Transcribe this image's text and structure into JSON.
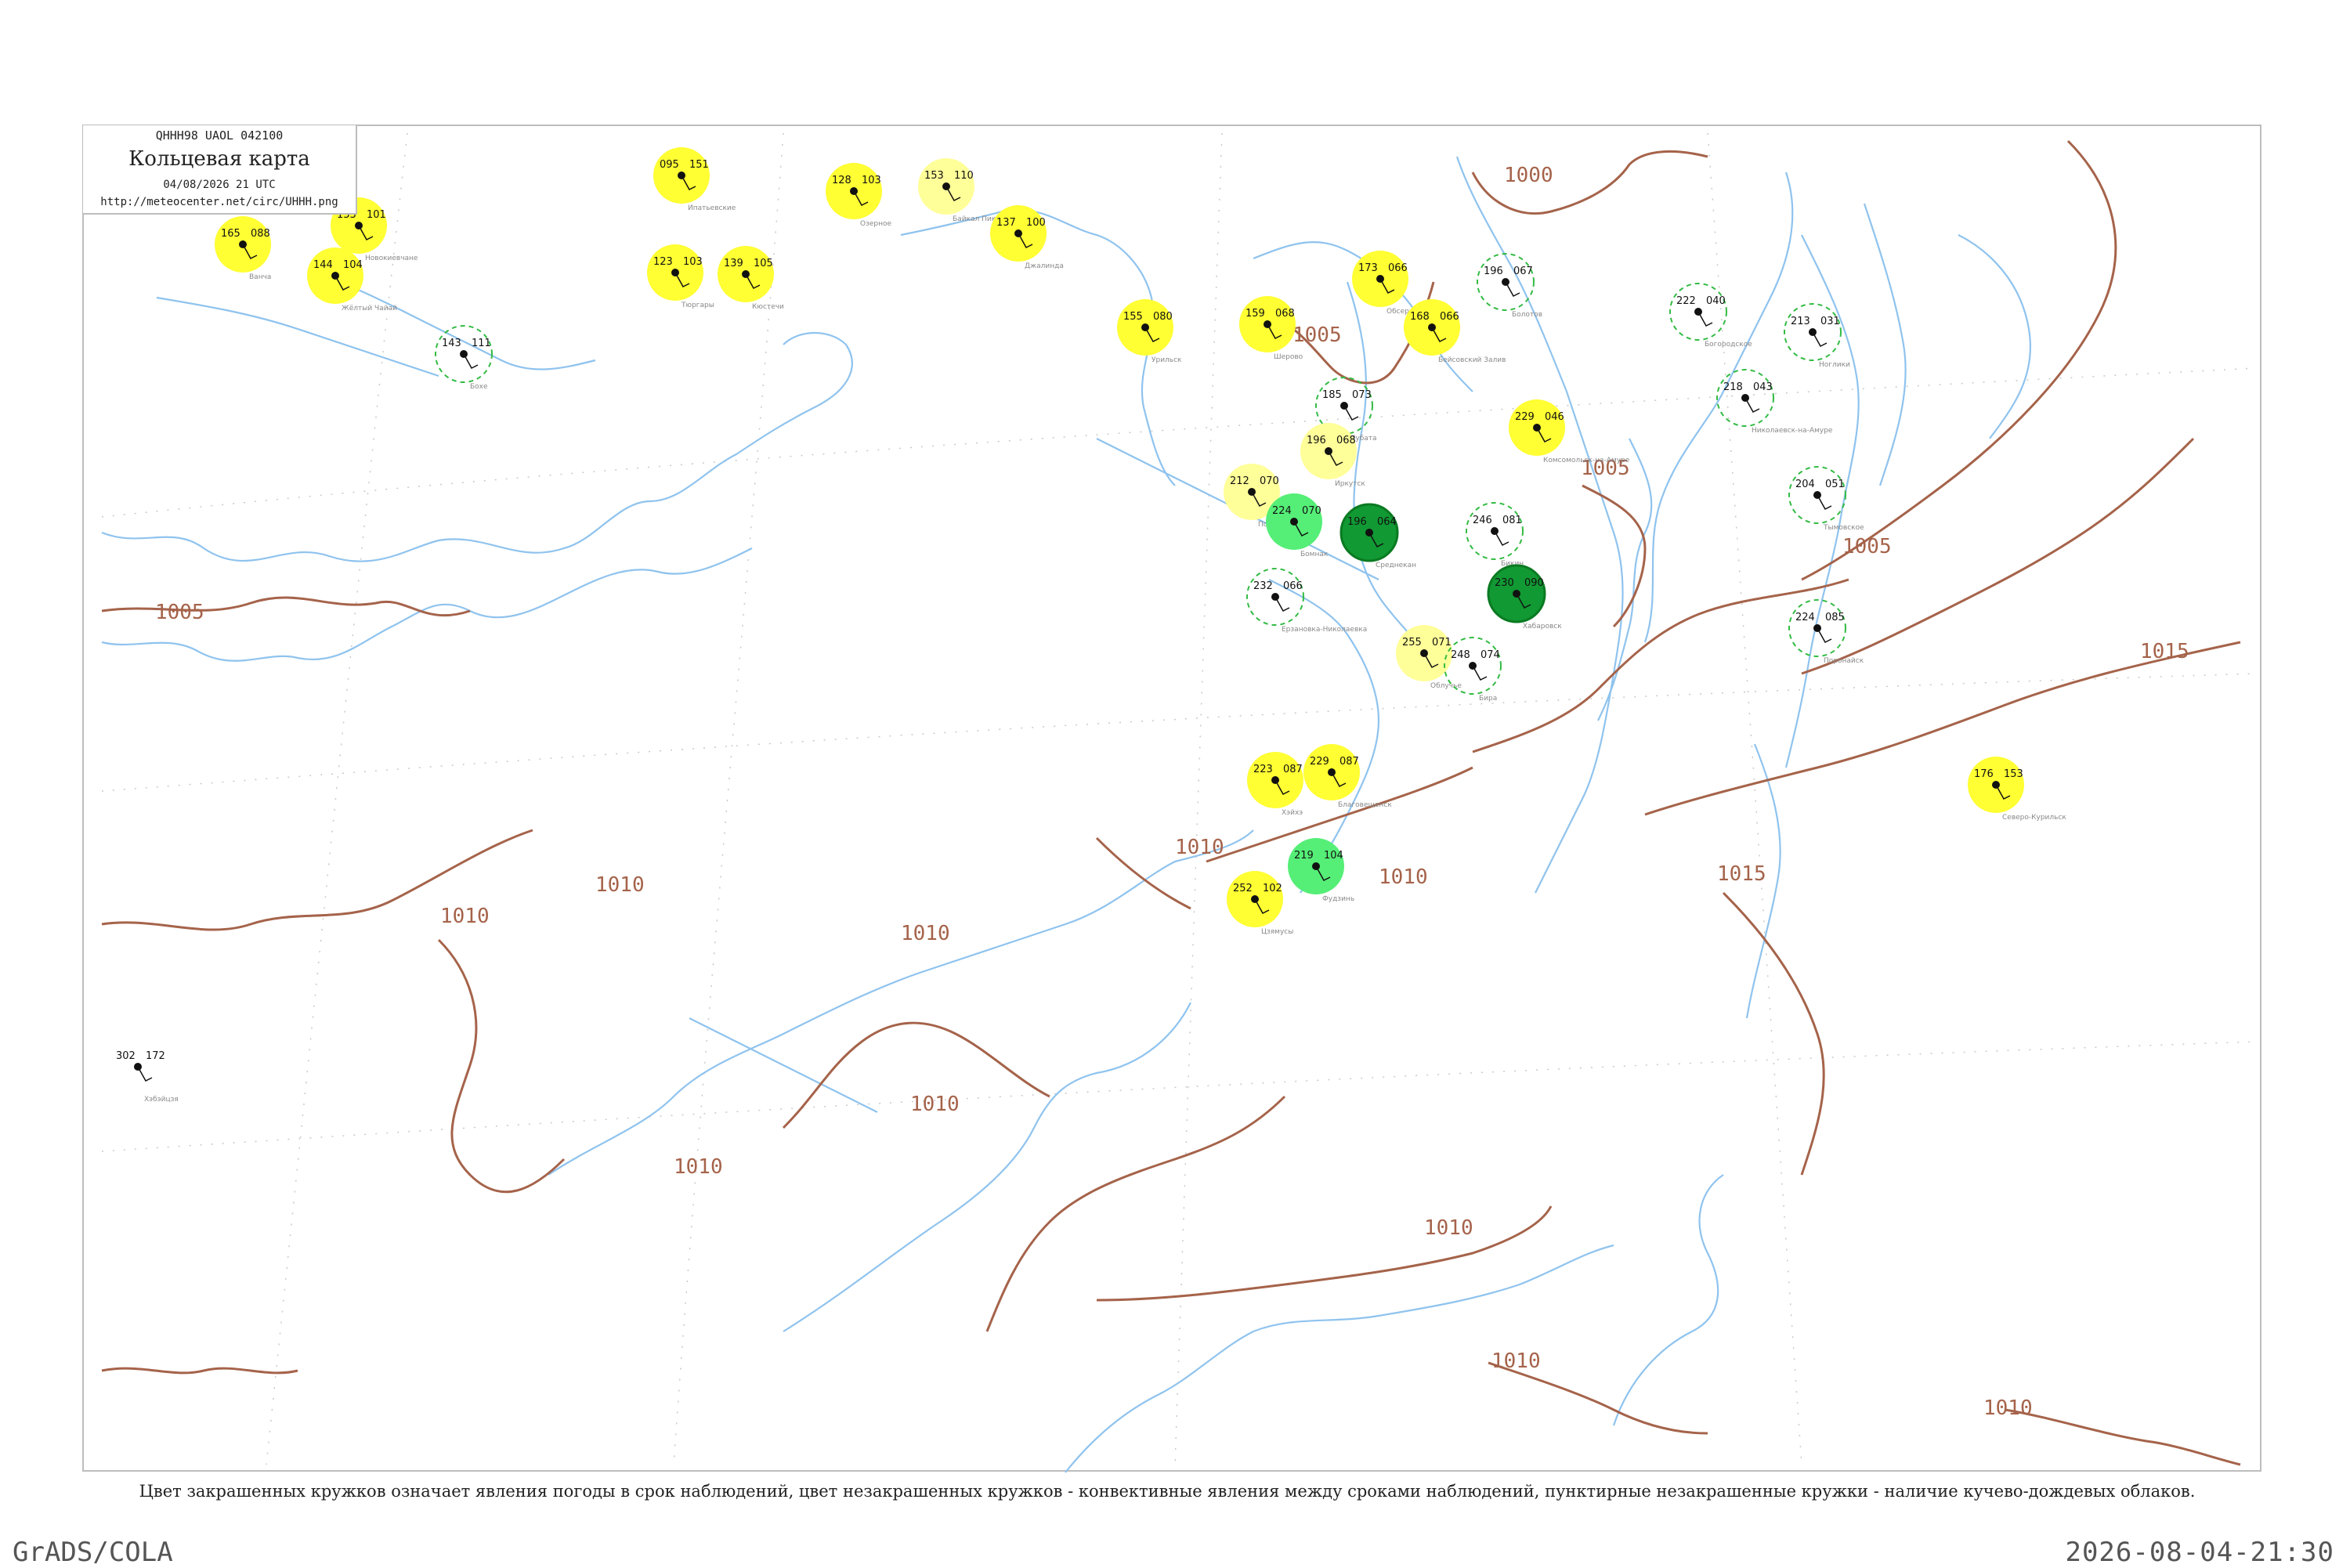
{
  "header": {
    "code": "QHHH98  UAOL  042100",
    "title": "Кольцевая карта",
    "date": "04/08/2026 21 UTC",
    "url": "http://meteocenter.net/circ/UHHH.png"
  },
  "caption": "Цвет закрашенных кружков означает явления погоды в срок наблюдений, цвет незакрашенных кружков - конвективные явления между сроками наблюдений, пунктирные незакрашенные кружки - наличие кучево-дождевых облаков.",
  "footer": {
    "left": "GrADS/COLA",
    "right": "2026-08-04-21:30"
  },
  "colors": {
    "isobar": "#a5634a",
    "coastline": "#8fc3ee",
    "yellow": "#ffff33",
    "light_yellow": "#ffff99",
    "green": "#55ee77",
    "dark_green": "#119933",
    "dashed_circle": "#33bb44"
  },
  "isobar_labels": [
    "1000",
    "1005",
    "1005",
    "1005",
    "1005",
    "1010",
    "1010",
    "1010",
    "1010",
    "1010",
    "1010",
    "1010",
    "1010",
    "1010",
    "1010",
    "1015",
    "1015"
  ],
  "stations": [
    {
      "t": "165",
      "p": "088",
      "marker": "yellow",
      "name": "Ванча"
    },
    {
      "t": "133",
      "p": "101",
      "marker": "yellow",
      "name": "Новокиевчане"
    },
    {
      "t": "144",
      "p": "104",
      "marker": "yellow",
      "name": "Жёлтый Чайай"
    },
    {
      "t": "143",
      "p": "111",
      "marker": "dashed",
      "name": "Бохе"
    },
    {
      "t": "095",
      "p": "151",
      "marker": "yellow",
      "name": "Ипатьевские"
    },
    {
      "t": "123",
      "p": "103",
      "marker": "yellow",
      "name": "Тюргары"
    },
    {
      "t": "139",
      "p": "105",
      "marker": "yellow",
      "name": "Кюстечи"
    },
    {
      "t": "128",
      "p": "103",
      "marker": "yellow",
      "name": "Озерное"
    },
    {
      "t": "153",
      "p": "110",
      "marker": "light_yellow",
      "name": "Байкал Пики"
    },
    {
      "t": "137",
      "p": "100",
      "marker": "yellow",
      "name": "Джалинда"
    },
    {
      "t": "155",
      "p": "080",
      "marker": "yellow",
      "name": "Урильск"
    },
    {
      "t": "159",
      "p": "068",
      "marker": "yellow",
      "name": "Шерово"
    },
    {
      "t": "173",
      "p": "066",
      "marker": "yellow",
      "name": "Обсерво"
    },
    {
      "t": "168",
      "p": "066",
      "marker": "yellow",
      "name": "Бейсовский Залив"
    },
    {
      "t": "196",
      "p": "067",
      "marker": "dashed",
      "name": "Болотов"
    },
    {
      "t": "185",
      "p": "073",
      "marker": "dashed",
      "name": "Кубата"
    },
    {
      "t": "196",
      "p": "068",
      "marker": "light_yellow",
      "name": "Иркутск"
    },
    {
      "t": "212",
      "p": "070",
      "marker": "light_yellow",
      "name": "Поярково"
    },
    {
      "t": "224",
      "p": "070",
      "marker": "green",
      "name": "Бомнак"
    },
    {
      "t": "196",
      "p": "064",
      "marker": "dark_green",
      "name": "Среднекан"
    },
    {
      "t": "232",
      "p": "066",
      "marker": "dashed",
      "name": "Ерзановка-Николаевка"
    },
    {
      "t": "229",
      "p": "046",
      "marker": "yellow",
      "name": "Комсомольск-на-Амуре"
    },
    {
      "t": "246",
      "p": "081",
      "marker": "dashed",
      "name": "Бикин"
    },
    {
      "t": "230",
      "p": "090",
      "marker": "dark_green",
      "name": "Хабаровск"
    },
    {
      "t": "255",
      "p": "071",
      "marker": "light_yellow",
      "name": "Облучье"
    },
    {
      "t": "248",
      "p": "074",
      "marker": "dashed",
      "name": "Бира"
    },
    {
      "t": "222",
      "p": "040",
      "marker": "dashed",
      "name": "Богородское"
    },
    {
      "t": "213",
      "p": "031",
      "marker": "dashed",
      "name": "Ноглики"
    },
    {
      "t": "218",
      "p": "043",
      "marker": "dashed",
      "name": "Николаевск-на-Амуре"
    },
    {
      "t": "204",
      "p": "051",
      "marker": "dashed",
      "name": "Тымовское"
    },
    {
      "t": "224",
      "p": "085",
      "marker": "dashed",
      "name": "Поронайск"
    },
    {
      "t": "229",
      "p": "087",
      "marker": "yellow",
      "name": "Благовещенск"
    },
    {
      "t": "223",
      "p": "087",
      "marker": "yellow",
      "name": "Хэйхэ"
    },
    {
      "t": "219",
      "p": "104",
      "marker": "green",
      "name": "Фудзинь"
    },
    {
      "t": "252",
      "p": "102",
      "marker": "yellow",
      "name": "Цзямусы"
    },
    {
      "t": "176",
      "p": "153",
      "marker": "yellow",
      "name": "Северо-Курильск"
    },
    {
      "t": "302",
      "p": "172",
      "marker": "none",
      "name": "Хэбэйцзя"
    }
  ]
}
